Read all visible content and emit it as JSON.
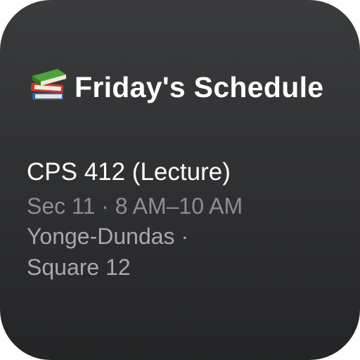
{
  "widget": {
    "title": "Friday's Schedule",
    "icon": "books-icon",
    "event": {
      "name": "CPS 412 (Lecture)",
      "time": "Sec 11 · 8 AM–10 AM",
      "location": "Yonge-Dundas · Square 12"
    }
  },
  "colors": {
    "background": "#2e2f31",
    "primary_text": "#ffffff",
    "secondary_text": "#8e8e93"
  }
}
